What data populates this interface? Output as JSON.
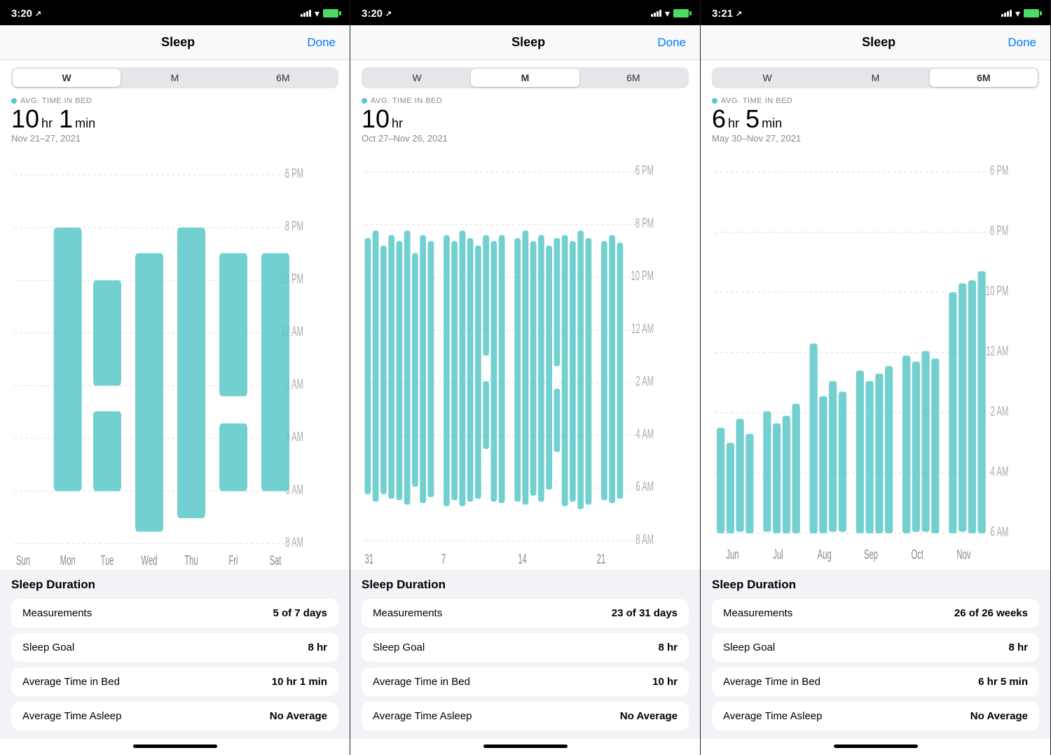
{
  "panels": [
    {
      "id": "panel-week",
      "status": {
        "time": "3:20",
        "arrow": "⇗"
      },
      "nav": {
        "title": "Sleep",
        "done": "Done"
      },
      "segments": [
        "W",
        "M",
        "6M"
      ],
      "active_segment": 0,
      "avg_label": "AVG. TIME IN BED",
      "stat_hours": "10",
      "stat_hr_unit": "hr",
      "stat_mins": "1",
      "stat_min_unit": "min",
      "date_range": "Nov 21–27, 2021",
      "chart_type": "week",
      "time_labels": [
        "6 PM",
        "8 PM",
        "10 PM",
        "12 AM",
        "2 AM",
        "4 AM",
        "6 AM",
        "8 AM"
      ],
      "day_labels": [
        "Sun",
        "Mon",
        "Tue",
        "Wed",
        "Thu",
        "Fri",
        "Sat"
      ],
      "sleep_duration_title": "Sleep Duration",
      "stats": [
        {
          "label": "Measurements",
          "value": "5 of 7 days"
        },
        {
          "label": "Sleep Goal",
          "value": "8 hr"
        },
        {
          "label": "Average Time in Bed",
          "value": "10 hr 1 min"
        },
        {
          "label": "Average Time Asleep",
          "value": "No Average"
        }
      ]
    },
    {
      "id": "panel-month",
      "status": {
        "time": "3:20",
        "arrow": "⇗"
      },
      "nav": {
        "title": "Sleep",
        "done": "Done"
      },
      "segments": [
        "W",
        "M",
        "6M"
      ],
      "active_segment": 1,
      "avg_label": "AVG. TIME IN BED",
      "stat_hours": "10",
      "stat_hr_unit": "hr",
      "stat_mins": "",
      "stat_min_unit": "",
      "date_range": "Oct 27–Nov 26, 2021",
      "chart_type": "month",
      "time_labels": [
        "6 PM",
        "8 PM",
        "10 PM",
        "12 AM",
        "2 AM",
        "4 AM",
        "6 AM",
        "8 AM"
      ],
      "day_labels": [
        "31",
        "7",
        "14",
        "21"
      ],
      "sleep_duration_title": "Sleep Duration",
      "stats": [
        {
          "label": "Measurements",
          "value": "23 of 31 days"
        },
        {
          "label": "Sleep Goal",
          "value": "8 hr"
        },
        {
          "label": "Average Time in Bed",
          "value": "10 hr"
        },
        {
          "label": "Average Time Asleep",
          "value": "No Average"
        }
      ]
    },
    {
      "id": "panel-6m",
      "status": {
        "time": "3:21",
        "arrow": "⇗"
      },
      "nav": {
        "title": "Sleep",
        "done": "Done"
      },
      "segments": [
        "W",
        "M",
        "6M"
      ],
      "active_segment": 2,
      "avg_label": "AVG. TIME IN BED",
      "stat_hours": "6",
      "stat_hr_unit": "hr",
      "stat_mins": "5",
      "stat_min_unit": "min",
      "date_range": "May 30–Nov 27, 2021",
      "chart_type": "6month",
      "time_labels": [
        "6 PM",
        "8 PM",
        "10 PM",
        "12 AM",
        "2 AM",
        "4 AM",
        "6 AM"
      ],
      "day_labels": [
        "Jun",
        "Jul",
        "Aug",
        "Sep",
        "Oct",
        "Nov"
      ],
      "sleep_duration_title": "Sleep Duration",
      "stats": [
        {
          "label": "Measurements",
          "value": "26 of 26 weeks"
        },
        {
          "label": "Sleep Goal",
          "value": "8 hr"
        },
        {
          "label": "Average Time in Bed",
          "value": "6 hr 5 min"
        },
        {
          "label": "Average Time Asleep",
          "value": "No Average"
        }
      ]
    }
  ]
}
